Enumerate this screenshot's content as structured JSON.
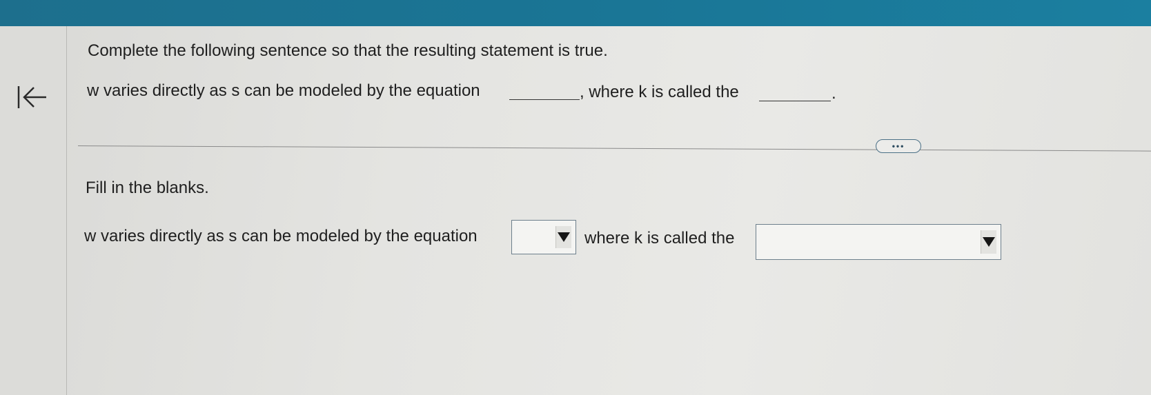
{
  "navigation": {
    "back_icon": "arrow-left-to-bar-icon"
  },
  "question": {
    "prompt": "Complete the following sentence so that the resulting statement is true.",
    "sentence_part1": "w varies directly as s can be modeled by the equation",
    "sentence_part2": ", where k is called the",
    "sentence_end": "."
  },
  "more_button": {
    "label": "•••"
  },
  "answer": {
    "instruction": "Fill in the blanks.",
    "sentence_part1": "w varies directly as s can be modeled by the equation",
    "sentence_part2": "where k is called the",
    "equation_select": {
      "value": ""
    },
    "term_select": {
      "value": ""
    }
  }
}
